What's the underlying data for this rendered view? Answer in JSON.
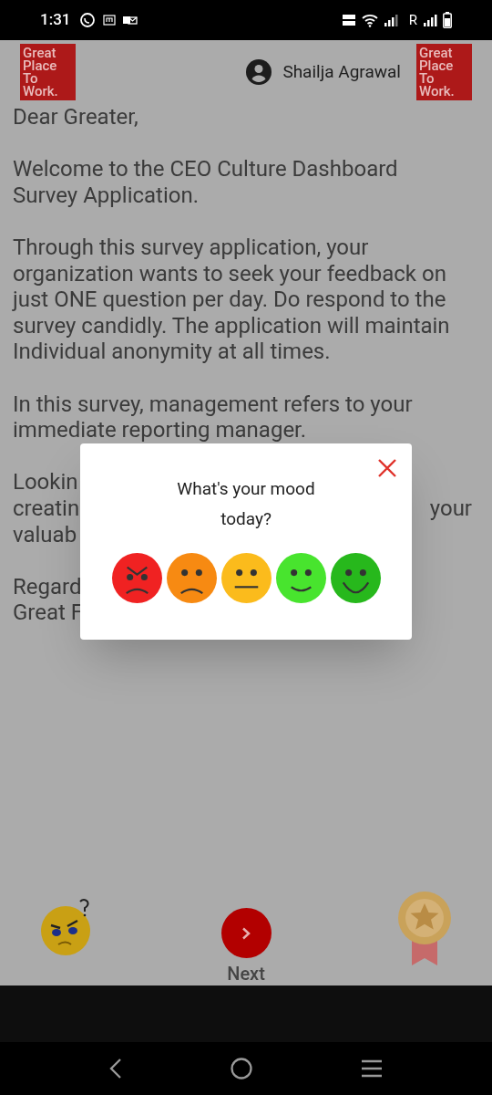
{
  "status_bar": {
    "time": "1:31",
    "roaming": "R"
  },
  "header": {
    "logo_left": [
      "Great",
      "Place",
      "To",
      "Work."
    ],
    "user_name": "Shailja Agrawal",
    "logo_right": [
      "Great",
      "Place",
      "To",
      "Work."
    ]
  },
  "letter": [
    {
      "lines": [
        {
          "left": "Dear Greater,"
        }
      ]
    },
    {
      "lines": [
        {
          "left": "Welcome to the CEO Culture Dashboard"
        },
        {
          "left": "Survey Application."
        }
      ]
    },
    {
      "lines": [
        {
          "left": "Through this survey application, your"
        },
        {
          "left": "organization wants to seek your feedback on"
        },
        {
          "left": "just ONE question per day. Do respond to the"
        },
        {
          "left": "survey candidly. The application will maintain"
        },
        {
          "left": "Individual anonymity at all times."
        }
      ]
    },
    {
      "lines": [
        {
          "left": "In this survey, management refers to your"
        },
        {
          "left": "immediate reporting manager."
        }
      ]
    },
    {
      "lines": [
        {
          "left": "Lookin"
        },
        {
          "left": "creatin",
          "right": "your"
        },
        {
          "left": "valuab"
        }
      ]
    },
    {
      "lines": [
        {
          "left": "Regard"
        },
        {
          "left": "Great F"
        }
      ]
    }
  ],
  "mood_dialog": {
    "title": "What's your mood today?",
    "moods": [
      {
        "kind": "angry",
        "color": "#f02222"
      },
      {
        "kind": "sad",
        "color": "#f78a12"
      },
      {
        "kind": "neutral",
        "color": "#fbbb1c"
      },
      {
        "kind": "smile",
        "color": "#48e42e"
      },
      {
        "kind": "happy",
        "color": "#27b81c"
      }
    ]
  },
  "footer": {
    "next_label": "Next"
  }
}
